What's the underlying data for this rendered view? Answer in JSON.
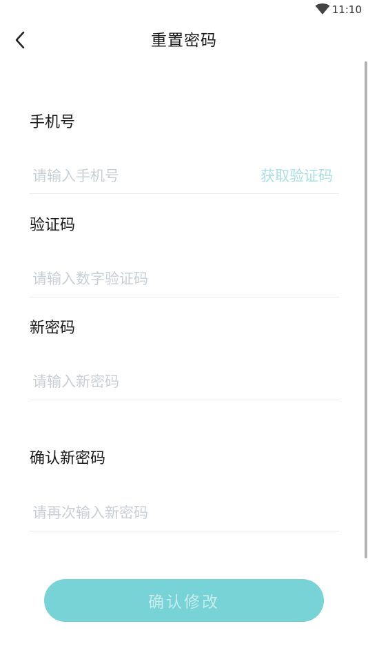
{
  "status_bar": {
    "time": "11:10",
    "wifi_icon": "wifi-icon"
  },
  "header": {
    "title": "重置密码",
    "back_icon": "chevron-left-icon"
  },
  "form": {
    "phone": {
      "label": "手机号",
      "placeholder": "请输入手机号",
      "value": "",
      "get_code_label": "获取验证码"
    },
    "code": {
      "label": "验证码",
      "placeholder": "请输入数字验证码",
      "value": ""
    },
    "new_password": {
      "label": "新密码",
      "placeholder": "请输入新密码",
      "value": ""
    },
    "confirm_password": {
      "label": "确认新密码",
      "placeholder": "请再次输入新密码",
      "value": ""
    }
  },
  "submit": {
    "label": "确认修改"
  },
  "colors": {
    "accent": "#78d3d6",
    "button_text": "#c6ecee",
    "link_disabled": "#a9e0e3",
    "placeholder": "#c9cfd4",
    "divider": "#ececec"
  }
}
